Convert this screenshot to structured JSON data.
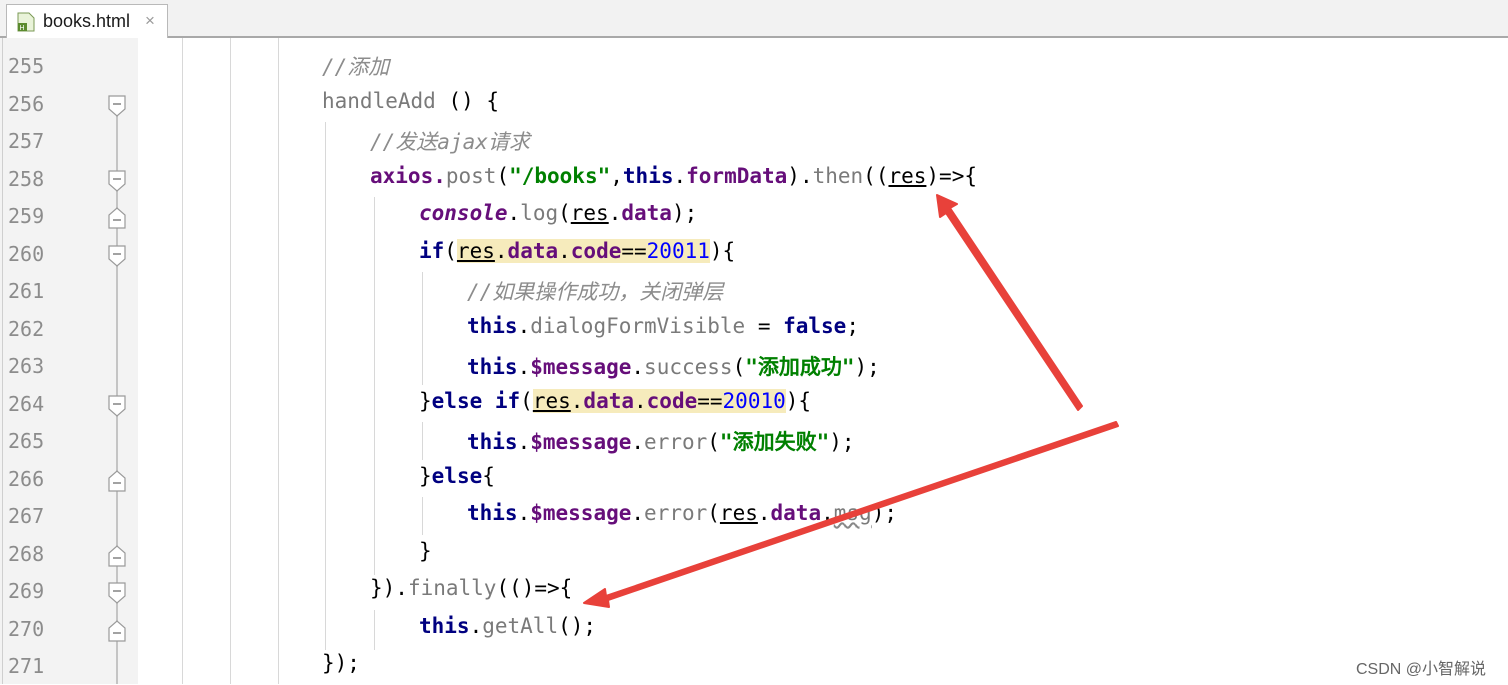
{
  "tab": {
    "filename": "books.html",
    "close": "×"
  },
  "watermark": "CSDN @小智解说",
  "lines": {
    "l255": {
      "num": "255",
      "t0": "//添加"
    },
    "l256": {
      "num": "256",
      "t0": "handleAdd",
      "t1": " () {"
    },
    "l257": {
      "num": "257",
      "t0": "//发送ajax请求"
    },
    "l258": {
      "num": "258",
      "t0": "axios.",
      "t1": "post",
      "t2": "(",
      "t3": "\"/books\"",
      "t4": ",",
      "t5": "this",
      "t6": ".",
      "t7": "formData",
      "t8": ").",
      "t9": "then",
      "t10": "((",
      "t11": "res",
      "t12": ")=>{"
    },
    "l259": {
      "num": "259",
      "t0": "console",
      "t1": ".",
      "t2": "log",
      "t3": "(",
      "t4": "res",
      "t5": ".",
      "t6": "data",
      "t7": ");"
    },
    "l260": {
      "num": "260",
      "t0": "if",
      "t1": "(",
      "t2": "res",
      "t3": ".",
      "t4": "data",
      "t5": ".",
      "t6": "code",
      "t7": "==",
      "t8": "20011",
      "t9": "){"
    },
    "l261": {
      "num": "261",
      "t0": "//如果操作成功，关闭弹层"
    },
    "l262": {
      "num": "262",
      "t0": "this",
      "t1": ".",
      "t2": "dialogFormVisible",
      "t3": " = ",
      "t4": "false",
      "t5": ";"
    },
    "l263": {
      "num": "263",
      "t0": "this",
      "t1": ".",
      "t2": "$message",
      "t3": ".",
      "t4": "success",
      "t5": "(",
      "t6": "\"添加成功\"",
      "t7": ");"
    },
    "l264": {
      "num": "264",
      "t0": "}",
      "t1": "else if",
      "t2": "(",
      "t3": "res",
      "t4": ".",
      "t5": "data",
      "t6": ".",
      "t7": "code",
      "t8": "==",
      "t9": "20010",
      "t10": "){"
    },
    "l265": {
      "num": "265",
      "t0": "this",
      "t1": ".",
      "t2": "$message",
      "t3": ".",
      "t4": "error",
      "t5": "(",
      "t6": "\"添加失败\"",
      "t7": ");"
    },
    "l266": {
      "num": "266",
      "t0": "}",
      "t1": "else",
      "t2": "{"
    },
    "l267": {
      "num": "267",
      "t0": "this",
      "t1": ".",
      "t2": "$message",
      "t3": ".",
      "t4": "error",
      "t5": "(",
      "t6": "res",
      "t7": ".",
      "t8": "data",
      "t9": ".",
      "t10": "msg",
      "t11": ");"
    },
    "l268": {
      "num": "268",
      "t0": "}"
    },
    "l269": {
      "num": "269",
      "t0": "}).",
      "t1": "finally",
      "t2": "(()=>{"
    },
    "l270": {
      "num": "270",
      "t0": "this",
      "t1": ".",
      "t2": "getAll",
      "t3": "();"
    },
    "l271": {
      "num": "271",
      "t0": "});"
    }
  },
  "colors": {
    "keyword": "#000080",
    "property": "#660e7a",
    "string": "#008000",
    "number": "#0000ff",
    "comment": "#8c8c8c",
    "annotation_arrow": "#e8413a"
  }
}
